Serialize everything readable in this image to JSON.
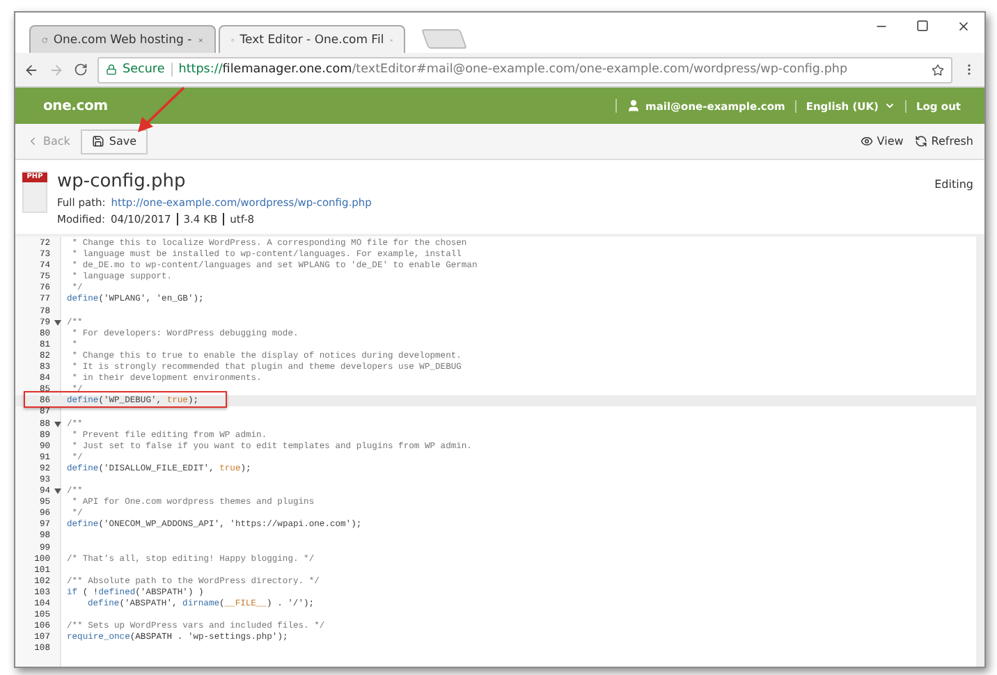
{
  "browser": {
    "tabs": [
      {
        "title": "One.com Web hosting -",
        "selected": false
      },
      {
        "title": "Text Editor - One.com Fil",
        "selected": true
      }
    ],
    "secure_label": "Secure",
    "url": {
      "scheme": "https://",
      "host": "filemanager.one.com",
      "path": "/textEditor#mail@one-example.com/one-example.com/wordpress/wp-config.php"
    }
  },
  "header": {
    "logo": "one.com",
    "user": "mail@one-example.com",
    "language": "English (UK)",
    "logout": "Log out"
  },
  "toolbar": {
    "back": {
      "label": "Back",
      "disabled": true
    },
    "save": "Save",
    "view": "View",
    "refresh": "Refresh"
  },
  "file": {
    "icon_label": "PHP",
    "name": "wp-config.php",
    "path_label": "Full path:",
    "path": "http://one-example.com/wordpress/wp-config.php",
    "status": "Editing",
    "modified_label": "Modified:",
    "modified": "04/10/2017",
    "size": "3.4 KB",
    "encoding": "utf-8"
  },
  "code": [
    {
      "number": "72",
      "fold": false,
      "highlighted": false,
      "tokens": [
        {
          "kind": "comment",
          "text": " * Change this to localize WordPress. A corresponding MO file for the chosen"
        }
      ]
    },
    {
      "number": "73",
      "fold": false,
      "highlighted": false,
      "tokens": [
        {
          "kind": "comment",
          "text": " * language must be installed to wp-content/languages. For example, install"
        }
      ]
    },
    {
      "number": "74",
      "fold": false,
      "highlighted": false,
      "tokens": [
        {
          "kind": "comment",
          "text": " * de_DE.mo to wp-content/languages and set WPLANG to 'de_DE' to enable German"
        }
      ]
    },
    {
      "number": "75",
      "fold": false,
      "highlighted": false,
      "tokens": [
        {
          "kind": "comment",
          "text": " * language support."
        }
      ]
    },
    {
      "number": "76",
      "fold": false,
      "highlighted": false,
      "tokens": [
        {
          "kind": "comment",
          "text": " */"
        }
      ]
    },
    {
      "number": "77",
      "fold": false,
      "highlighted": false,
      "tokens": [
        {
          "kind": "keyword",
          "text": "define"
        },
        {
          "kind": "plain",
          "text": "("
        },
        {
          "kind": "string",
          "text": "'WPLANG'"
        },
        {
          "kind": "plain",
          "text": ", "
        },
        {
          "kind": "string",
          "text": "'en_GB'"
        },
        {
          "kind": "plain",
          "text": ");"
        }
      ]
    },
    {
      "number": "78",
      "fold": false,
      "highlighted": false
    },
    {
      "number": "79",
      "fold": true,
      "highlighted": false,
      "tokens": [
        {
          "kind": "comment",
          "text": "/**"
        }
      ]
    },
    {
      "number": "80",
      "fold": false,
      "highlighted": false,
      "tokens": [
        {
          "kind": "comment",
          "text": " * For developers: WordPress debugging mode."
        }
      ]
    },
    {
      "number": "81",
      "fold": false,
      "highlighted": false,
      "tokens": [
        {
          "kind": "comment",
          "text": " *"
        }
      ]
    },
    {
      "number": "82",
      "fold": false,
      "highlighted": false,
      "tokens": [
        {
          "kind": "comment",
          "text": " * Change this to true to enable the display of notices during development."
        }
      ]
    },
    {
      "number": "83",
      "fold": false,
      "highlighted": false,
      "tokens": [
        {
          "kind": "comment",
          "text": " * It is strongly recommended that plugin and theme developers use WP_DEBUG"
        }
      ]
    },
    {
      "number": "84",
      "fold": false,
      "highlighted": false,
      "tokens": [
        {
          "kind": "comment",
          "text": " * in their development environments."
        }
      ]
    },
    {
      "number": "85",
      "fold": false,
      "highlighted": false,
      "tokens": [
        {
          "kind": "comment",
          "text": " */"
        }
      ]
    },
    {
      "number": "86",
      "fold": false,
      "highlighted": true,
      "tokens": [
        {
          "kind": "keyword",
          "text": "define"
        },
        {
          "kind": "plain",
          "text": "("
        },
        {
          "kind": "string",
          "text": "'WP_DEBUG'"
        },
        {
          "kind": "plain",
          "text": ", "
        },
        {
          "kind": "constant",
          "text": "true"
        },
        {
          "kind": "plain",
          "text": ");"
        }
      ]
    },
    {
      "number": "87",
      "fold": false,
      "highlighted": false
    },
    {
      "number": "88",
      "fold": true,
      "highlighted": false,
      "tokens": [
        {
          "kind": "comment",
          "text": "/**"
        }
      ]
    },
    {
      "number": "89",
      "fold": false,
      "highlighted": false,
      "tokens": [
        {
          "kind": "comment",
          "text": " * Prevent file editing from WP admin."
        }
      ]
    },
    {
      "number": "90",
      "fold": false,
      "highlighted": false,
      "tokens": [
        {
          "kind": "comment",
          "text": " * Just set to false if you want to edit templates and plugins from WP admin."
        }
      ]
    },
    {
      "number": "91",
      "fold": false,
      "highlighted": false,
      "tokens": [
        {
          "kind": "comment",
          "text": " */"
        }
      ]
    },
    {
      "number": "92",
      "fold": false,
      "highlighted": false,
      "tokens": [
        {
          "kind": "keyword",
          "text": "define"
        },
        {
          "kind": "plain",
          "text": "("
        },
        {
          "kind": "string",
          "text": "'DISALLOW_FILE_EDIT'"
        },
        {
          "kind": "plain",
          "text": ", "
        },
        {
          "kind": "constant",
          "text": "true"
        },
        {
          "kind": "plain",
          "text": ");"
        }
      ]
    },
    {
      "number": "93",
      "fold": false,
      "highlighted": false
    },
    {
      "number": "94",
      "fold": true,
      "highlighted": false,
      "tokens": [
        {
          "kind": "comment",
          "text": "/**"
        }
      ]
    },
    {
      "number": "95",
      "fold": false,
      "highlighted": false,
      "tokens": [
        {
          "kind": "comment",
          "text": " * API for One.com wordpress themes and plugins"
        }
      ]
    },
    {
      "number": "96",
      "fold": false,
      "highlighted": false,
      "tokens": [
        {
          "kind": "comment",
          "text": " */"
        }
      ]
    },
    {
      "number": "97",
      "fold": false,
      "highlighted": false,
      "tokens": [
        {
          "kind": "keyword",
          "text": "define"
        },
        {
          "kind": "plain",
          "text": "("
        },
        {
          "kind": "string",
          "text": "'ONECOM_WP_ADDONS_API'"
        },
        {
          "kind": "plain",
          "text": ", "
        },
        {
          "kind": "string",
          "text": "'https://wpapi.one.com'"
        },
        {
          "kind": "plain",
          "text": ");"
        }
      ]
    },
    {
      "number": "98",
      "fold": false,
      "highlighted": false
    },
    {
      "number": "99",
      "fold": false,
      "highlighted": false
    },
    {
      "number": "100",
      "fold": false,
      "highlighted": false,
      "tokens": [
        {
          "kind": "comment",
          "text": "/* That's all, stop editing! Happy blogging. */"
        }
      ]
    },
    {
      "number": "101",
      "fold": false,
      "highlighted": false
    },
    {
      "number": "102",
      "fold": false,
      "highlighted": false,
      "tokens": [
        {
          "kind": "comment",
          "text": "/** Absolute path to the WordPress directory. */"
        }
      ]
    },
    {
      "number": "103",
      "fold": false,
      "highlighted": false,
      "tokens": [
        {
          "kind": "keyword",
          "text": "if"
        },
        {
          "kind": "plain",
          "text": " ( !"
        },
        {
          "kind": "keyword",
          "text": "defined"
        },
        {
          "kind": "plain",
          "text": "("
        },
        {
          "kind": "string",
          "text": "'ABSPATH'"
        },
        {
          "kind": "plain",
          "text": ") )"
        }
      ]
    },
    {
      "number": "104",
      "indented": true,
      "fold": false,
      "highlighted": false,
      "tokens": [
        {
          "kind": "keyword",
          "text": "define"
        },
        {
          "kind": "plain",
          "text": "("
        },
        {
          "kind": "string",
          "text": "'ABSPATH'"
        },
        {
          "kind": "plain",
          "text": ", "
        },
        {
          "kind": "keyword",
          "text": "dirname"
        },
        {
          "kind": "plain",
          "text": "("
        },
        {
          "kind": "constant",
          "text": "__FILE__"
        },
        {
          "kind": "plain",
          "text": ") . "
        },
        {
          "kind": "string",
          "text": "'/'"
        },
        {
          "kind": "plain",
          "text": ");"
        }
      ]
    },
    {
      "number": "105",
      "fold": false,
      "highlighted": false
    },
    {
      "number": "106",
      "fold": false,
      "highlighted": false,
      "tokens": [
        {
          "kind": "comment",
          "text": "/** Sets up WordPress vars and included files. */"
        }
      ]
    },
    {
      "number": "107",
      "fold": false,
      "highlighted": false,
      "tokens": [
        {
          "kind": "keyword",
          "text": "require_once"
        },
        {
          "kind": "plain",
          "text": "(ABSPATH . "
        },
        {
          "kind": "string",
          "text": "'wp-settings.php'"
        },
        {
          "kind": "plain",
          "text": ");"
        }
      ]
    },
    {
      "number": "108",
      "fold": false,
      "highlighted": false
    }
  ]
}
